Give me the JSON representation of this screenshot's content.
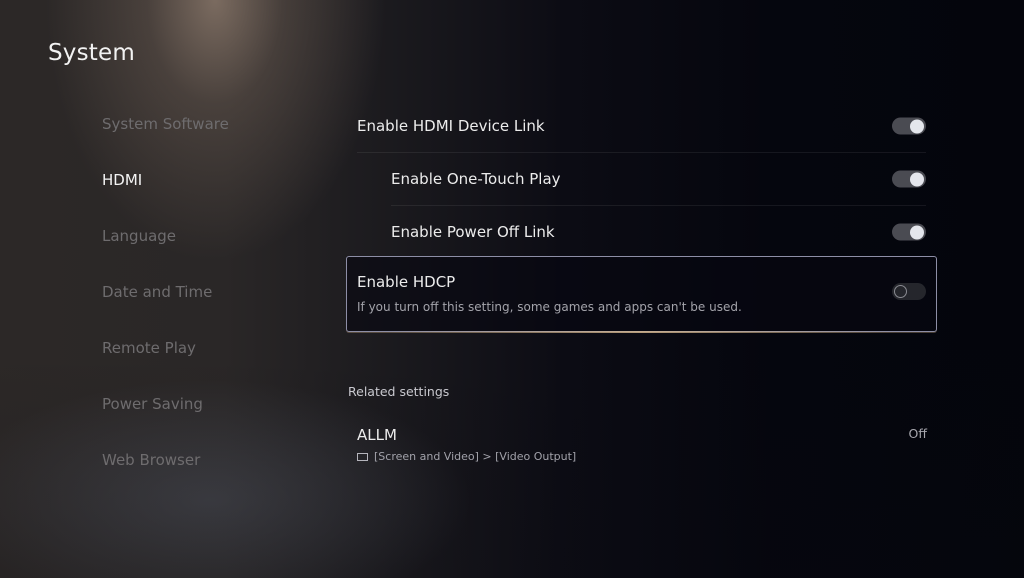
{
  "page": {
    "title": "System"
  },
  "sidebar": {
    "items": [
      {
        "label": "System Software",
        "active": false
      },
      {
        "label": "HDMI",
        "active": true
      },
      {
        "label": "Language",
        "active": false
      },
      {
        "label": "Date and Time",
        "active": false
      },
      {
        "label": "Remote Play",
        "active": false
      },
      {
        "label": "Power Saving",
        "active": false
      },
      {
        "label": "Web Browser",
        "active": false
      }
    ]
  },
  "settings": {
    "hdmi_device_link": {
      "label": "Enable HDMI Device Link",
      "state": "on"
    },
    "one_touch_play": {
      "label": "Enable One-Touch Play",
      "state": "on"
    },
    "power_off_link": {
      "label": "Enable Power Off Link",
      "state": "on"
    },
    "hdcp": {
      "label": "Enable HDCP",
      "description": "If you turn off this setting, some games and apps can't be used.",
      "state": "off"
    }
  },
  "related": {
    "title": "Related settings",
    "items": [
      {
        "label": "ALLM",
        "value": "Off",
        "path": "[Screen and Video] > [Video Output]",
        "icon": "screen-icon"
      }
    ]
  },
  "colors": {
    "focus_border": "#8d8ea6",
    "toggle_on_track": "#4a4b52",
    "toggle_knob": "#e4e6ec"
  }
}
